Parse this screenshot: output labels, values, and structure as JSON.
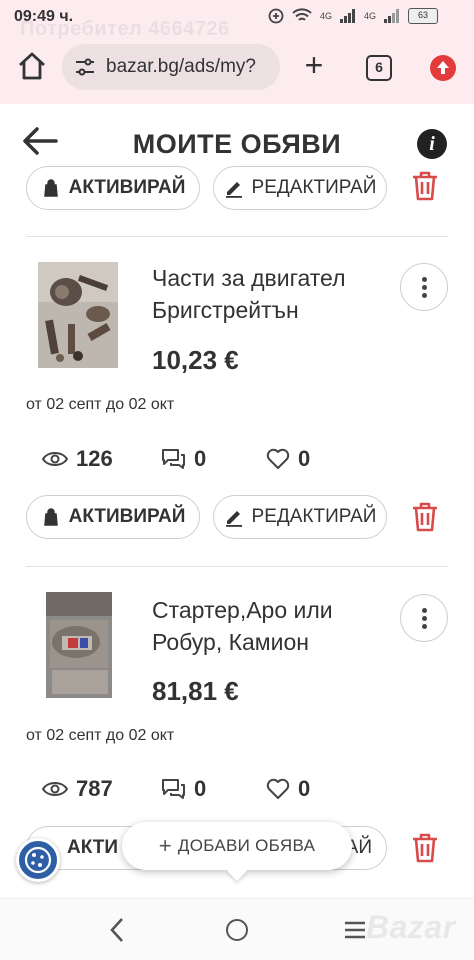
{
  "status_bar": {
    "time": "09:49 ч.",
    "watermark": "Потребител 4664726",
    "battery": "63",
    "signal": "4G"
  },
  "browser": {
    "url": "bazar.bg/ads/my?",
    "tab_count": "6"
  },
  "header": {
    "title": "МОИТЕ ОБЯВИ"
  },
  "labels": {
    "activate": "АКТИВИРАЙ",
    "edit": "РЕДАКТИРАЙ",
    "activate_partial": "АКТИ",
    "edit_partial": "АЙ"
  },
  "listings": [
    {
      "title": "Части за двигател Бригстрейтън",
      "price": "10,23 €",
      "dates": "от 02 септ до 02 окт",
      "views": "126",
      "messages": "0",
      "likes": "0"
    },
    {
      "title": "Стартер,Аро или Робур, Камион",
      "price": "81,81 €",
      "dates": "от 02 септ до 02 окт",
      "views": "787",
      "messages": "0",
      "likes": "0"
    }
  ],
  "add_button": {
    "plus": "+",
    "label": "ДОБАВИ ОБЯВА"
  },
  "navbar": {
    "logo": "Bazar"
  },
  "colors": {
    "accent_red": "#d94a4a",
    "chrome_bg": "#fcecef"
  }
}
